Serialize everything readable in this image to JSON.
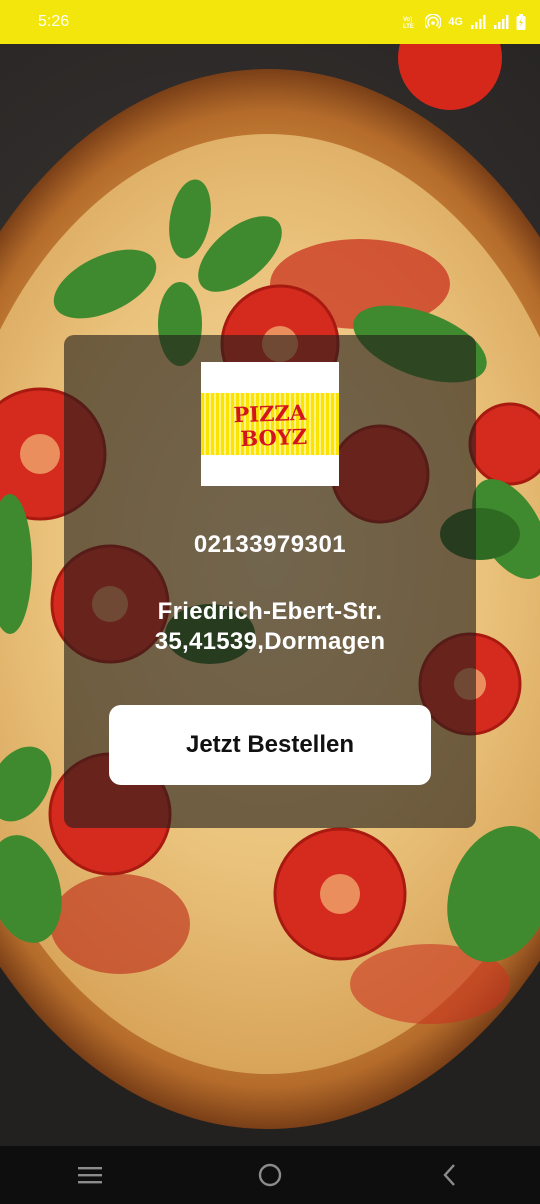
{
  "status_bar": {
    "time": "5:26",
    "network": "4G",
    "volte": "VoLTE",
    "background_color": "#f2e60c"
  },
  "background": {
    "icon": "pizza-image"
  },
  "card": {
    "logo_text_line1": "PIZZA",
    "logo_text_line2": "BOYZ",
    "phone": "02133979301",
    "address_line1": "Friedrich-Ebert-Str.",
    "address_line2": "35,41539,Dormagen",
    "order_button": "Jetzt Bestellen"
  },
  "nav_bar": {
    "recents_icon": "menu-icon",
    "home_icon": "home-circle-icon",
    "back_icon": "back-chevron-icon"
  }
}
